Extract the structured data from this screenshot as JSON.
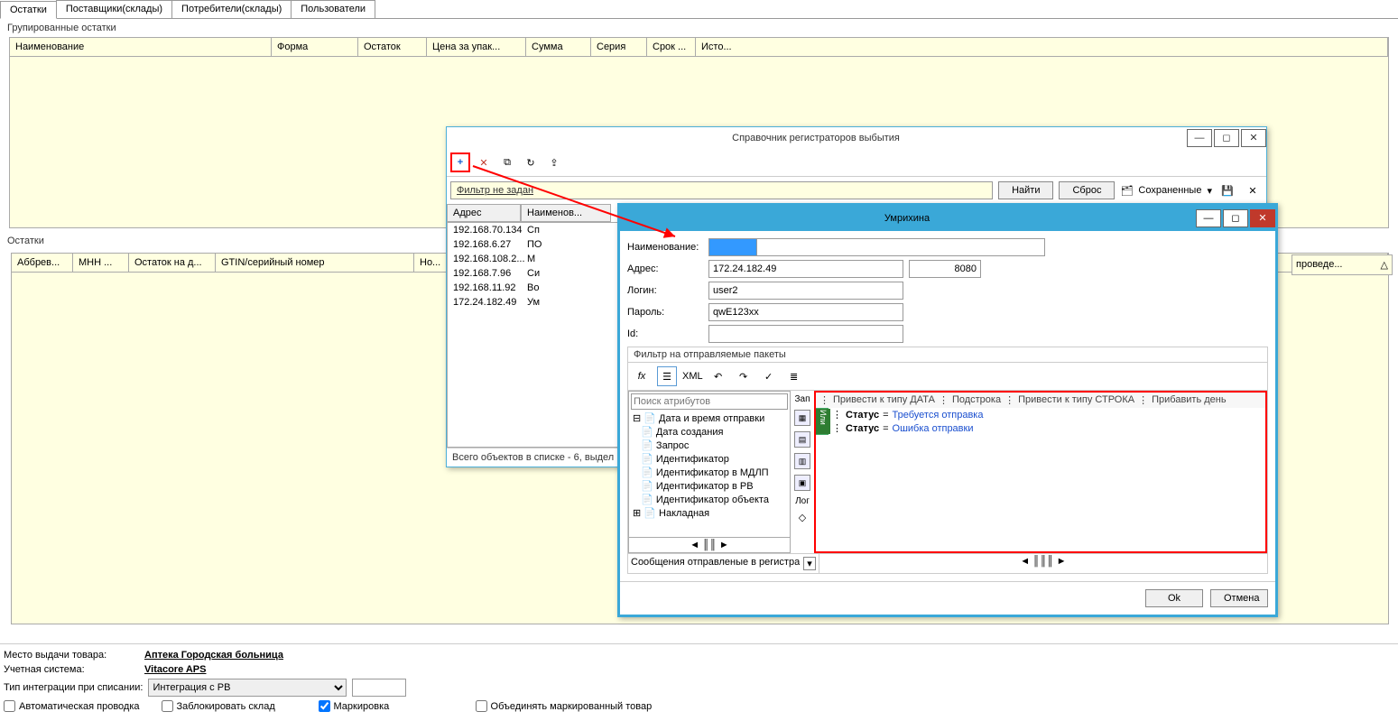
{
  "tabs": [
    "Остатки",
    "Поставщики(склады)",
    "Потребители(склады)",
    "Пользователи"
  ],
  "section1": "Групированные остатки",
  "grid1cols": {
    "c0": "Наименование",
    "c1": "Форма",
    "c2": "Остаток",
    "c3": "Цена за упак...",
    "c4": "Сумма",
    "c5": "Серия",
    "c6": "Срок ...",
    "c7": "Исто..."
  },
  "section2": "Остатки",
  "grid2cols": {
    "c0": "Аббрев...",
    "c1": "МНН ...",
    "c2": "Остаток на д...",
    "c3": "GTIN/серийный номер",
    "c4": "Но..."
  },
  "rightcol": "проведе...",
  "dlg1": {
    "title": "Справочник регистраторов выбытия",
    "filter": "Фильтр не задан",
    "find": "Найти",
    "reset": "Сброс",
    "saved": "Сохраненные",
    "col_addr": "Адрес",
    "col_name": "Наименов...",
    "rows": [
      {
        "a": "192.168.70.134",
        "n": "Сп"
      },
      {
        "a": "192.168.6.27",
        "n": "ПО"
      },
      {
        "a": "192.168.108.2...",
        "n": "М"
      },
      {
        "a": "192.168.7.96",
        "n": "Си"
      },
      {
        "a": "192.168.11.92",
        "n": "Во"
      },
      {
        "a": "172.24.182.49",
        "n": "Ум"
      }
    ],
    "status": "Всего объектов в списке - 6, выдел"
  },
  "dlg2": {
    "title": "Умрихина",
    "lbl_name": "Наименование:",
    "name": "",
    "lbl_addr": "Адрес:",
    "addr": "172.24.182.49",
    "port": "8080",
    "lbl_login": "Логин:",
    "login": "user2",
    "lbl_pass": "Пароль:",
    "pass": "qwE123xx",
    "lbl_id": "Id:",
    "id": "",
    "fg_title": "Фильтр на отправляемые пакеты",
    "xml": "XML",
    "attr_search": "Поиск атрибутов",
    "attrs": [
      "Дата и время отправки",
      "Дата создания",
      "Запрос",
      "Идентификатор",
      "Идентификатор в МДЛП",
      "Идентификатор в РВ",
      "Идентификатор объекта",
      "Накладная"
    ],
    "zap": "Зап",
    "log": "Лог",
    "cond_funcs": [
      "Привести к типу ДАТА",
      "Подстрока",
      "Привести к типу СТРОКА",
      "Прибавить день"
    ],
    "or": "Или",
    "cond1_f": "Статус",
    "cond1_op": "=",
    "cond1_v": "Требуется отправка",
    "cond2_f": "Статус",
    "cond2_op": "=",
    "cond2_v": "Ошибка отправки",
    "msg": "Сообщения отправленые в регистра",
    "ok": "Ok",
    "cancel": "Отмена"
  },
  "footer": {
    "l1": "Место выдачи товара:",
    "v1": "Аптека Городская больница",
    "l2": "Учетная система:",
    "v2": "Vitacore APS",
    "l3": "Тип интеграции при списании:",
    "v3": "Интеграция с РВ",
    "cb1": "Автоматическая проводка",
    "cb2": "Заблокировать склад",
    "cb3": "Маркировка",
    "cb4": "Объединять маркированный товар"
  }
}
